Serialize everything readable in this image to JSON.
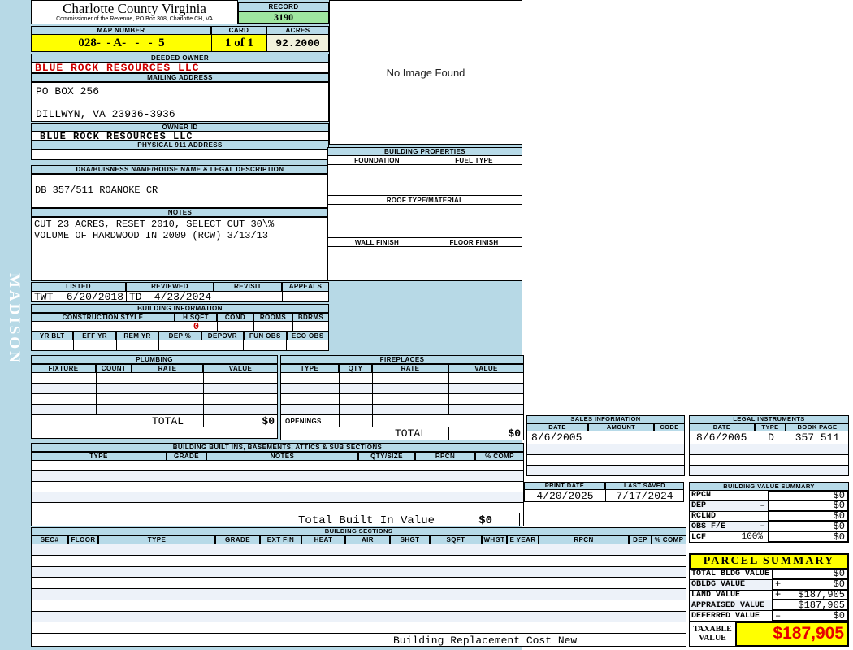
{
  "app": {
    "watermark": "MADISON"
  },
  "header": {
    "county_name": "Charlotte County Virginia",
    "county_subtitle": "Commissioner of the Revenue, PO Box 308, Charlotte CH, VA",
    "record_label": "RECORD",
    "record_value": "3190",
    "map_number_label": "MAP NUMBER",
    "map_number_value": "028-  - A-   -   -  5",
    "card_label": "CARD",
    "card_value": "1 of 1",
    "acres_label": "ACRES",
    "acres_value": "92.2000"
  },
  "owner": {
    "deeded_owner_label": "DEEDED OWNER",
    "deeded_owner": "BLUE ROCK RESOURCES LLC",
    "mailing_address_label": "MAILING ADDRESS",
    "mailing_line1": "PO BOX 256",
    "mailing_line2": "DILLWYN, VA 23936-3936",
    "owner_id_label": "OWNER ID",
    "owner_id": "BLUE ROCK RESOURCES LLC",
    "physical_address_label": "PHYSICAL 911 ADDRESS",
    "dba_label": "DBA/BUISNESS NAME/HOUSE NAME & LEGAL DESCRIPTION",
    "dba_value": "DB 357/511 ROANOKE CR",
    "notes_label": "NOTES",
    "notes_line1": "CUT 23 ACRES, RESET 2010, SELECT CUT 30\\%",
    "notes_line2": "VOLUME OF HARDWOOD IN 2009 (RCW) 3/13/13"
  },
  "review": {
    "listed_label": "LISTED",
    "listed_by": "TWT",
    "listed_date": "6/20/2018",
    "reviewed_label": "REVIEWED",
    "reviewed_by": "TD",
    "reviewed_date": "4/23/2024",
    "revisit_label": "REVISIT",
    "appeals_label": "APPEALS"
  },
  "building_information": {
    "title": "BUILDING INFORMATION",
    "construction_style_label": "CONSTRUCTION STYLE",
    "h_sqft_label": "H SQFT",
    "h_sqft_value": "0",
    "cond_label": "COND",
    "rooms_label": "ROOMS",
    "bdrms_label": "BDRMS",
    "yr_blt_label": "YR BLT",
    "eff_yr_label": "EFF YR",
    "rem_yr_label": "REM YR",
    "dep_pct_label": "DEP %",
    "depovr_label": "DEPOVR",
    "fun_obs_label": "FUN OBS",
    "eco_obs_label": "ECO OBS"
  },
  "plumbing": {
    "title": "PLUMBING",
    "col_fixture": "FIXTURE",
    "col_count": "COUNT",
    "col_rate": "RATE",
    "col_value": "VALUE",
    "total_label": "TOTAL",
    "total_value": "$0"
  },
  "fireplaces": {
    "title": "FIREPLACES",
    "col_type": "TYPE",
    "col_qty": "QTY",
    "col_rate": "RATE",
    "col_value": "VALUE",
    "openings_label": "OPENINGS",
    "total_label": "TOTAL",
    "total_value": "$0"
  },
  "built_ins": {
    "title": "BUILDING BUILT INS, BASEMENTS, ATTICS & SUB SECTIONS",
    "col_type": "TYPE",
    "col_grade": "GRADE",
    "col_notes": "NOTES",
    "col_qty_size": "QTY/SIZE",
    "col_rpcn": "RPCN",
    "col_comp": "% COMP",
    "total_label": "Total Built In Value",
    "total_value": "$0"
  },
  "building_sections": {
    "title": "BUILDING SECTIONS",
    "columns": [
      "SEC#",
      "FLOOR",
      "TYPE",
      "GRADE",
      "EXT FIN",
      "HEAT",
      "AIR",
      "SHGT",
      "SQFT",
      "WHGT",
      "E YEAR",
      "RPCN",
      "DEP",
      "% COMP"
    ],
    "footer_label": "Building Replacement Cost New"
  },
  "image_panel": {
    "no_image_text": "No Image Found"
  },
  "building_properties": {
    "title": "BUILDING PROPERTIES",
    "foundation_label": "FOUNDATION",
    "fuel_type_label": "FUEL TYPE",
    "roof_label": "ROOF TYPE/MATERIAL",
    "wall_label": "WALL FINISH",
    "floor_label": "FLOOR FINISH"
  },
  "sales_information": {
    "title": "SALES INFORMATION",
    "col_date": "DATE",
    "col_amount": "AMOUNT",
    "col_code": "CODE",
    "rows": [
      {
        "date": "8/6/2005",
        "amount": "",
        "code": ""
      }
    ]
  },
  "legal_instruments": {
    "title": "LEGAL INSTRUMENTS",
    "col_date": "DATE",
    "col_type": "TYPE",
    "col_book_page": "BOOK PAGE",
    "rows": [
      {
        "date": "8/6/2005",
        "type": "D",
        "book_page": "357 511"
      }
    ]
  },
  "print_info": {
    "print_date_label": "PRINT DATE",
    "print_date": "4/20/2025",
    "last_saved_label": "LAST SAVED",
    "last_saved": "7/17/2024"
  },
  "building_value_summary": {
    "title": "BUILDING VALUE SUMMARY",
    "rows": [
      {
        "label": "RPCN",
        "op": "",
        "extra": "",
        "value": "$0"
      },
      {
        "label": "DEP",
        "op": "–",
        "extra": "",
        "value": "$0"
      },
      {
        "label": "RCLND",
        "op": "",
        "extra": "",
        "value": "$0"
      },
      {
        "label": "OBS F/E",
        "op": "–",
        "extra": "",
        "value": "$0"
      },
      {
        "label": "LCF",
        "op": "",
        "extra": "100%",
        "value": "$0"
      }
    ]
  },
  "parcel_summary": {
    "title": "PARCEL SUMMARY",
    "rows": [
      {
        "label": "TOTAL BLDG VALUE",
        "op": "",
        "value": "$0"
      },
      {
        "label": "OBLDG VALUE",
        "op": "+",
        "value": "$0"
      },
      {
        "label": "LAND VALUE",
        "op": "+",
        "value": "$187,905"
      },
      {
        "label": "APPRAISED VALUE",
        "op": "",
        "value": "$187,905"
      },
      {
        "label": "DEFERRED VALUE",
        "op": "–",
        "value": "$0"
      }
    ],
    "taxable_label_1": "TAXABLE",
    "taxable_label_2": "VALUE",
    "taxable_value": "$187,905"
  },
  "colors": {
    "header_blue": "#b7dae8",
    "record_green": "#9fe6a0",
    "highlight_yellow": "#ffff00",
    "acres_cream": "#f1f1dc",
    "owner_red": "#cc0000",
    "taxable_red": "#e60000"
  }
}
